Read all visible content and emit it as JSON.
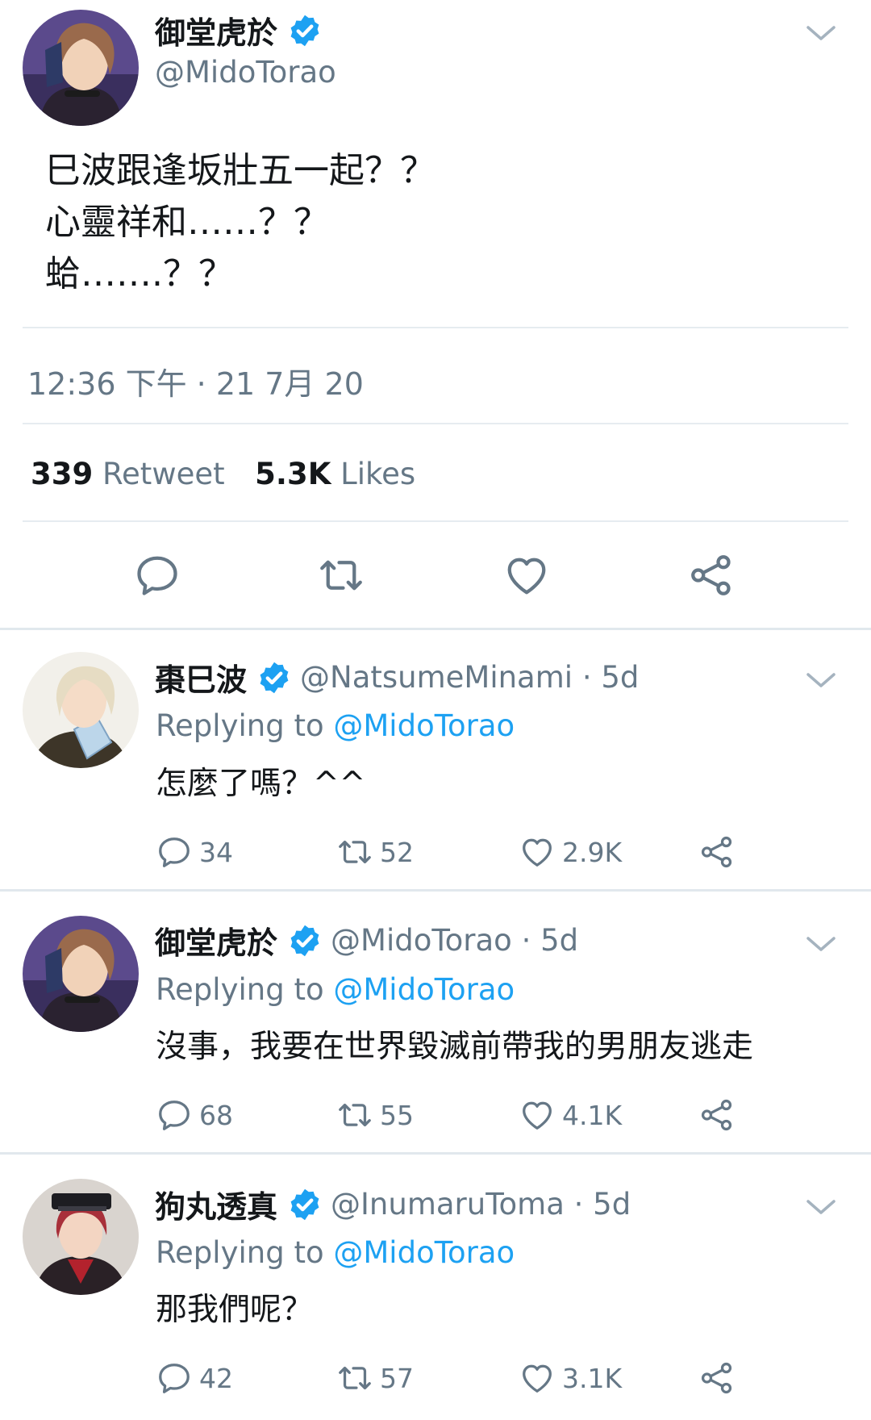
{
  "main_tweet": {
    "author_name": "御堂虎於",
    "author_handle": "@MidoTorao",
    "verified": true,
    "body": "巳波跟逢坂壯五一起？？\n心靈祥和……？？\n蛤…….？？",
    "timestamp": "12:36 下午 · 21 7月 20",
    "retweet_count": "339",
    "retweet_label": "Retweet",
    "like_count": "5.3K",
    "like_label": "Likes"
  },
  "replies": [
    {
      "author_name": "棗巳波",
      "author_handle": "@NatsumeMinami · 5d",
      "replying_prefix": "Replying to",
      "replying_to": "@MidoTorao",
      "text": "怎麼了嗎？^^",
      "reply_count": "34",
      "retweet_count": "52",
      "like_count": "2.9K"
    },
    {
      "author_name": "御堂虎於",
      "author_handle": "@MidoTorao · 5d",
      "replying_prefix": "Replying to",
      "replying_to": "@MidoTorao",
      "text": "沒事，我要在世界毀滅前帶我的男朋友逃走",
      "reply_count": "68",
      "retweet_count": "55",
      "like_count": "4.1K"
    },
    {
      "author_name": "狗丸透真",
      "author_handle": "@InumaruToma · 5d",
      "replying_prefix": "Replying to",
      "replying_to": "@MidoTorao",
      "text": "那我們呢？",
      "reply_count": "42",
      "retweet_count": "57",
      "like_count": "3.1K"
    }
  ],
  "icons": {
    "verified": "verified-badge-icon",
    "menu": "chevron-down-icon",
    "reply": "reply-bubble-icon",
    "retweet": "retweet-icon",
    "like": "heart-icon",
    "share": "share-icon"
  },
  "colors": {
    "accent": "#1da1f2",
    "secondary_text": "#657786",
    "primary_text": "#14171a",
    "divider": "#e6ecf0"
  }
}
